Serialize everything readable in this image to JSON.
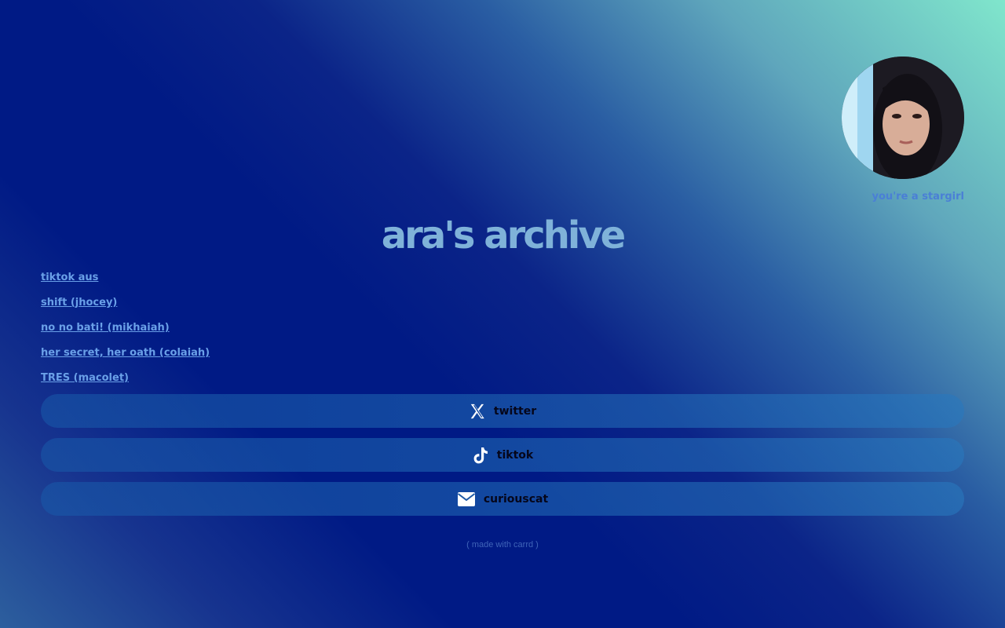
{
  "profile": {
    "tagline": "you're a stargirl"
  },
  "title": "ara's archive",
  "links": [
    {
      "label": "tiktok aus"
    },
    {
      "label": "shift (jhocey)"
    },
    {
      "label": "no no bati! (mikhaiah)"
    },
    {
      "label": "her secret, her oath (colaiah)"
    },
    {
      "label": "TRES (macolet)"
    }
  ],
  "buttons": [
    {
      "label": "twitter",
      "icon": "x-logo-icon"
    },
    {
      "label": "tiktok",
      "icon": "tiktok-logo-icon"
    },
    {
      "label": "curiouscat",
      "icon": "envelope-icon"
    }
  ],
  "footer": "( made with carrd )",
  "colors": {
    "title": "#7fb2d9",
    "link": "#6aa0e8",
    "button_text": "#05061a",
    "background_dark": "#001a85",
    "background_light": "#80e6cc"
  }
}
